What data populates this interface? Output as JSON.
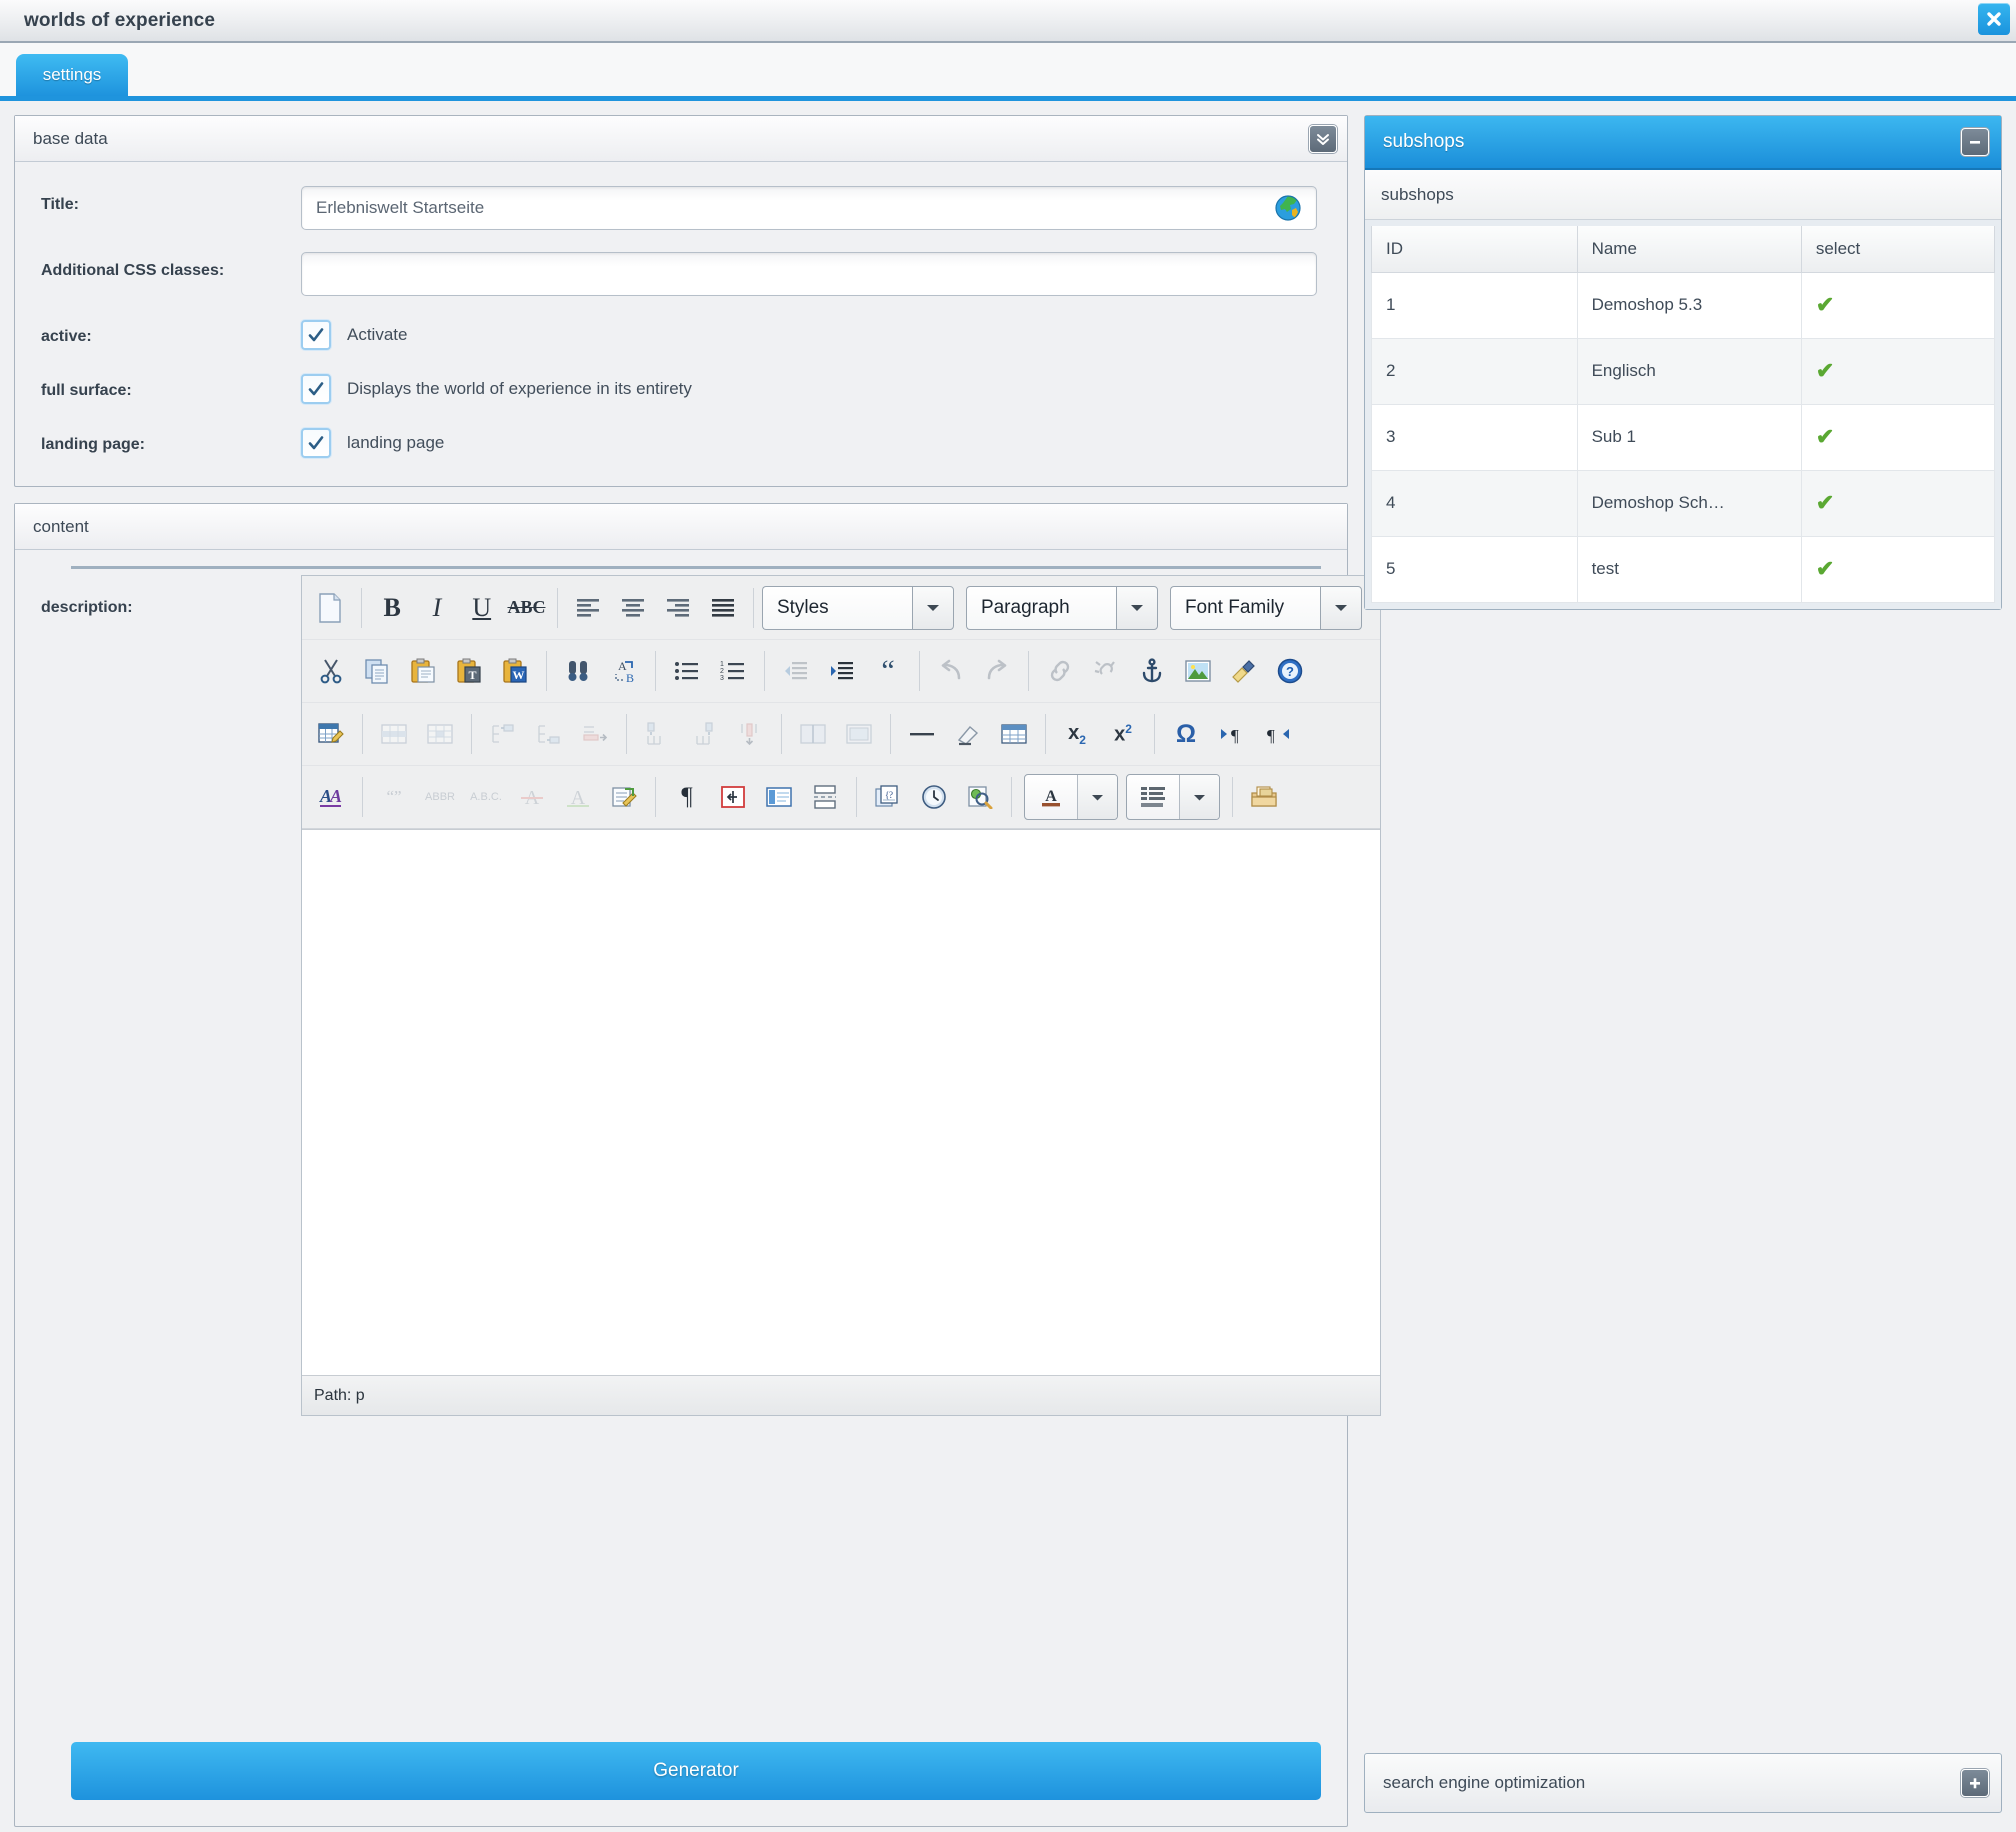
{
  "window": {
    "title": "worlds of experience",
    "close_icon": "close-icon"
  },
  "tabs": [
    {
      "label": "settings",
      "active": true
    }
  ],
  "base_data": {
    "header": "base data",
    "collapse_icon": "chevron-double-down-icon",
    "fields": {
      "title_label": "Title:",
      "title_value": "Erlebniswelt Startseite",
      "title_placeholder": "",
      "globe_icon": "globe-icon",
      "css_label": "Additional CSS classes:",
      "css_value": "",
      "css_placeholder": "",
      "active_label": "active:",
      "active_checkbox_label": "Activate",
      "active_checked": true,
      "full_surface_label": "full surface:",
      "full_surface_checkbox_label": "Displays the world of experience in its entirety",
      "full_surface_checked": true,
      "landing_page_label": "landing page:",
      "landing_page_checkbox_label": "landing page",
      "landing_page_checked": true
    }
  },
  "content": {
    "header": "content",
    "description_label": "description:",
    "editor": {
      "styles_value": "Styles",
      "paragraph_value": "Paragraph",
      "font_family_value": "Font Family",
      "body_text": "",
      "status_path": "Path: p",
      "toolbar_row1": [
        {
          "name": "new-document-icon",
          "disabled": false
        },
        {
          "name": "bold-icon",
          "disabled": false
        },
        {
          "name": "italic-icon",
          "disabled": false
        },
        {
          "name": "underline-icon",
          "disabled": false
        },
        {
          "name": "strikethrough-icon",
          "disabled": false
        },
        {
          "name": "align-left-icon",
          "disabled": false
        },
        {
          "name": "align-center-icon",
          "disabled": false
        },
        {
          "name": "align-right-icon",
          "disabled": false
        },
        {
          "name": "align-justify-icon",
          "disabled": false
        }
      ],
      "toolbar_row2": [
        {
          "name": "cut-icon",
          "disabled": false
        },
        {
          "name": "copy-icon",
          "disabled": false
        },
        {
          "name": "paste-icon",
          "disabled": false
        },
        {
          "name": "paste-as-text-icon",
          "disabled": false
        },
        {
          "name": "paste-from-word-icon",
          "disabled": false
        },
        {
          "name": "find-icon",
          "disabled": false
        },
        {
          "name": "find-replace-icon",
          "disabled": false
        },
        {
          "name": "bullet-list-icon",
          "disabled": false
        },
        {
          "name": "numbered-list-icon",
          "disabled": false
        },
        {
          "name": "outdent-icon",
          "disabled": true
        },
        {
          "name": "indent-icon",
          "disabled": false
        },
        {
          "name": "blockquote-icon",
          "disabled": false
        },
        {
          "name": "undo-icon",
          "disabled": true
        },
        {
          "name": "redo-icon",
          "disabled": true
        },
        {
          "name": "insert-link-icon",
          "disabled": true
        },
        {
          "name": "unlink-icon",
          "disabled": true
        },
        {
          "name": "anchor-icon",
          "disabled": false
        },
        {
          "name": "insert-image-icon",
          "disabled": false
        },
        {
          "name": "clean-up-icon",
          "disabled": false
        },
        {
          "name": "help-icon",
          "disabled": false
        }
      ],
      "toolbar_row3": [
        {
          "name": "table-properties-icon",
          "disabled": false
        },
        {
          "name": "table-row-properties-icon",
          "disabled": true
        },
        {
          "name": "table-cell-properties-icon",
          "disabled": true
        },
        {
          "name": "insert-row-before-icon",
          "disabled": true
        },
        {
          "name": "insert-row-after-icon",
          "disabled": true
        },
        {
          "name": "delete-row-icon",
          "disabled": true
        },
        {
          "name": "insert-column-before-icon",
          "disabled": true
        },
        {
          "name": "insert-column-after-icon",
          "disabled": true
        },
        {
          "name": "delete-column-icon",
          "disabled": true
        },
        {
          "name": "split-cells-icon",
          "disabled": true
        },
        {
          "name": "merge-cells-icon",
          "disabled": true
        },
        {
          "name": "horizontal-rule-icon",
          "disabled": false
        },
        {
          "name": "remove-format-icon",
          "disabled": false
        },
        {
          "name": "insert-table-icon",
          "disabled": false
        },
        {
          "name": "subscript-icon",
          "disabled": false
        },
        {
          "name": "superscript-icon",
          "disabled": false
        },
        {
          "name": "special-character-icon",
          "disabled": false
        },
        {
          "name": "ltr-icon",
          "disabled": false
        },
        {
          "name": "rtl-icon",
          "disabled": false
        }
      ],
      "toolbar_row4": [
        {
          "name": "style-props-icon",
          "disabled": false
        },
        {
          "name": "citation-icon",
          "disabled": true
        },
        {
          "name": "abbreviation-icon",
          "disabled": true
        },
        {
          "name": "acronym-icon",
          "disabled": true
        },
        {
          "name": "delete-text-icon",
          "disabled": true
        },
        {
          "name": "insert-text-icon",
          "disabled": true
        },
        {
          "name": "attributes-icon",
          "disabled": false
        },
        {
          "name": "show-blocks-icon",
          "disabled": false
        },
        {
          "name": "nonbreaking-icon",
          "disabled": false
        },
        {
          "name": "insert-layer-icon",
          "disabled": false
        },
        {
          "name": "page-break-icon",
          "disabled": false
        },
        {
          "name": "template-icon",
          "disabled": false
        },
        {
          "name": "insert-time-icon",
          "disabled": false
        },
        {
          "name": "preview-icon",
          "disabled": false
        },
        {
          "name": "text-color-icon",
          "disabled": false
        },
        {
          "name": "background-color-icon",
          "disabled": false
        },
        {
          "name": "media-manager-icon",
          "disabled": false
        }
      ]
    },
    "generator_button": "Generator"
  },
  "subshops": {
    "header": "subshops",
    "collapse_icon": "minus-icon",
    "subheader": "subshops",
    "columns": [
      "ID",
      "Name",
      "select"
    ],
    "rows": [
      {
        "id": "1",
        "name": "Demoshop 5.3",
        "selected": true
      },
      {
        "id": "2",
        "name": "Englisch",
        "selected": true
      },
      {
        "id": "3",
        "name": "Sub 1",
        "selected": true
      },
      {
        "id": "4",
        "name": "Demoshop Sch…",
        "selected": true
      },
      {
        "id": "5",
        "name": "test",
        "selected": true
      }
    ],
    "check_icon": "check-icon",
    "check_color": "#5aa832"
  },
  "seo": {
    "header": "search engine optimization",
    "expand_icon": "plus-icon"
  },
  "colors": {
    "accent": "#1e92dd",
    "accent_light": "#3fbbf2",
    "panel_bg": "#f0f1f3",
    "text": "#36424e"
  }
}
